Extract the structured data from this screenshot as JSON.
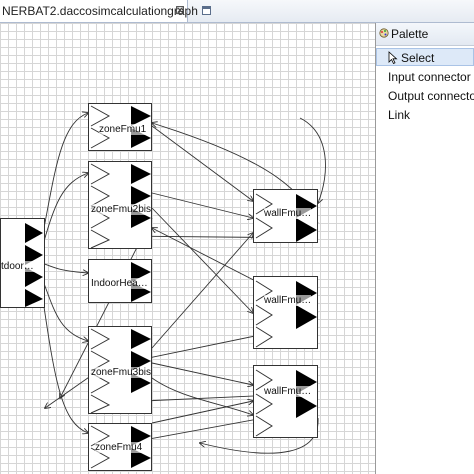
{
  "editor": {
    "tab_title": "NERBAT2.daccosimcalculationgraph",
    "close_glyph": "⊠"
  },
  "palette": {
    "title": "Palette",
    "items": [
      {
        "label": "Select",
        "selected": true
      },
      {
        "label": "Input connector",
        "selected": false
      },
      {
        "label": "Output connector",
        "selected": false
      },
      {
        "label": "Link",
        "selected": false
      }
    ]
  },
  "nodes": {
    "outdoor": "tdoor…",
    "zone1": "zoneFmu1",
    "zone2bis": "zoneFmu2bis",
    "indoor": "IndoorHea…",
    "zone3bis": "zoneFmu3bis",
    "zone4": "zoneFmu4",
    "wall1": "wallFmu…",
    "wall2": "wallFmu…",
    "wall3": "wallFmu…"
  },
  "colors": {
    "port": "#000000",
    "link": "#333333",
    "selection": "#dde9f8"
  }
}
